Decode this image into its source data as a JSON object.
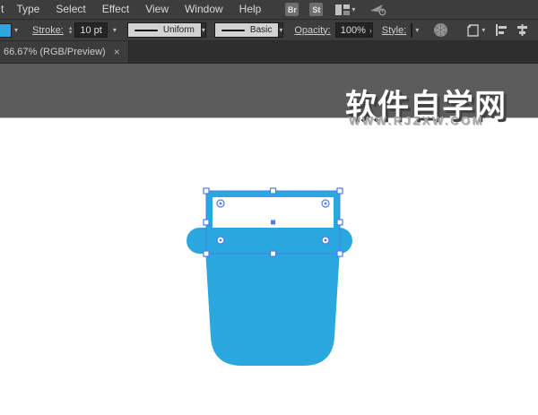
{
  "colors": {
    "art_blue": "#2BA7E0",
    "selection_blue": "#4A7DE8",
    "chrome": "#3D3D3D",
    "tabbar": "#2E2E2E",
    "pasteboard": "#5C5C5C",
    "canvas": "#FFFFFF"
  },
  "menubar": {
    "items": [
      "t",
      "Type",
      "Select",
      "Effect",
      "View",
      "Window",
      "Help"
    ],
    "br_button": "Br",
    "st_button": "St"
  },
  "controlbar": {
    "stroke_label": "Stroke:",
    "stroke_weight": "10 pt",
    "width_profile": "Uniform",
    "brush_definition": "Basic",
    "opacity_label": "Opacity:",
    "opacity_value": "100%",
    "style_label": "Style:"
  },
  "tabbar": {
    "active_tab": "66.67% (RGB/Preview)"
  },
  "watermark": {
    "title": "软件自学网",
    "url": "WWW.RJZXW.COM"
  },
  "icons": {
    "dropdown": "▾",
    "stepper_up": "▴",
    "stepper_down": "▾",
    "expand": "›",
    "close": "×"
  }
}
